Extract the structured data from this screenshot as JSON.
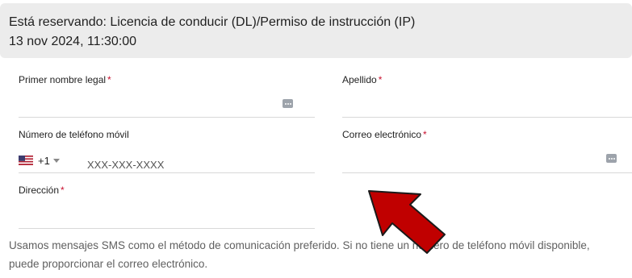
{
  "banner": {
    "reserving": "Está reservando: Licencia de conducir (DL)/Permiso de instrucción (IP)",
    "datetime": "13 nov 2024, 11:30:00"
  },
  "form": {
    "required_mark": "*",
    "first_name": {
      "label": "Primer nombre legal",
      "value": "",
      "required": true
    },
    "last_name": {
      "label": "Apellido",
      "value": "",
      "required": true
    },
    "phone": {
      "label": "Número de teléfono móvil",
      "country_flag": "us-flag-icon",
      "dial_code": "+1",
      "placeholder": "XXX-XXX-XXXX",
      "value": "",
      "required": false
    },
    "email": {
      "label": "Correo electrónico",
      "value": "",
      "required": true
    },
    "address": {
      "label": "Dirección",
      "value": "",
      "required": true
    }
  },
  "helper_text": "Usamos mensajes SMS como el método de comunicación preferido. Si no tiene un número de teléfono móvil disponible, puede proporcionar el correo electrónico.",
  "colors": {
    "banner_bg": "#ececec",
    "required": "#c8102e",
    "arrow": "#c00000",
    "divider": "#d8d8d8"
  },
  "annotation": {
    "icon": "red-arrow-icon"
  }
}
